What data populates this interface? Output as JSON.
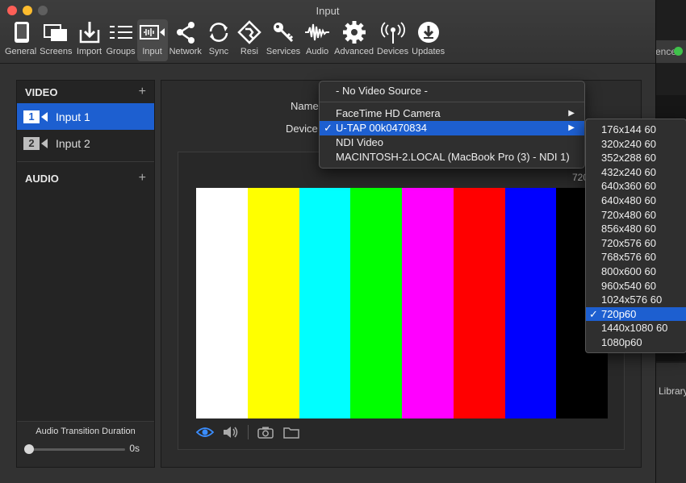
{
  "window": {
    "title": "Input"
  },
  "toolbar": {
    "items": [
      {
        "label": "General",
        "icon": "general-icon"
      },
      {
        "label": "Screens",
        "icon": "screens-icon"
      },
      {
        "label": "Import",
        "icon": "import-icon"
      },
      {
        "label": "Groups",
        "icon": "groups-icon"
      },
      {
        "label": "Input",
        "icon": "input-icon",
        "active": true
      },
      {
        "label": "Network",
        "icon": "network-icon"
      },
      {
        "label": "Sync",
        "icon": "sync-icon"
      },
      {
        "label": "Resi",
        "icon": "resi-icon"
      },
      {
        "label": "Services",
        "icon": "services-key-icon"
      },
      {
        "label": "Audio",
        "icon": "audio-waveform-icon"
      },
      {
        "label": "Advanced",
        "icon": "advanced-gear-icon"
      },
      {
        "label": "Devices",
        "icon": "devices-antenna-icon"
      },
      {
        "label": "Updates",
        "icon": "updates-download-icon"
      }
    ]
  },
  "sidebar": {
    "video_header": "VIDEO",
    "audio_header": "AUDIO",
    "add_symbol": "+",
    "inputs": [
      {
        "num": "1",
        "label": "Input 1"
      },
      {
        "num": "2",
        "label": "Input 2"
      }
    ],
    "audio_transition_label": "Audio Transition Duration",
    "audio_transition_value": "0s",
    "audio_transition_fraction": 0
  },
  "main": {
    "name_label": "Name",
    "device_label": "Device",
    "resolution": "720"
  },
  "device_menu": {
    "none_item": "- No Video Source -",
    "items": [
      {
        "label": "FaceTime HD Camera",
        "submenu": true
      },
      {
        "label": "U-TAP  00k0470834",
        "submenu": true,
        "checked": true
      },
      {
        "label": "NDI Video"
      },
      {
        "label": "MACINTOSH-2.LOCAL (MacBook Pro (3) - NDI 1)"
      }
    ],
    "check": "✓",
    "arrow": "▶"
  },
  "format_menu": {
    "items": [
      "176x144 60",
      "320x240 60",
      "352x288 60",
      "432x240 60",
      "640x360 60",
      "640x480 60",
      "720x480 60",
      "856x480 60",
      "720x576 60",
      "768x576 60",
      "800x600 60",
      "960x540 60",
      "1024x576 60",
      "720p60",
      "1440x1080 60",
      "1080p60"
    ],
    "selected_index": 13,
    "check": "✓"
  },
  "color_bars": [
    "#ffffff",
    "#ffff00",
    "#00ffff",
    "#00ff00",
    "#ff00ff",
    "#ff0000",
    "#0000ff",
    "#000000"
  ],
  "background": {
    "partial_label_1": "ence",
    "partial_label_2": "Library"
  },
  "colors": {
    "accent": "#1d5fd0"
  }
}
